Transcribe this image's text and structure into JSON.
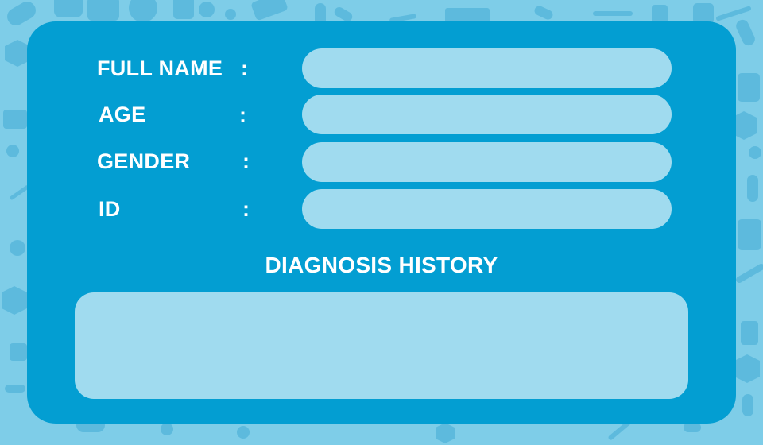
{
  "colors": {
    "background": "#7ecde8",
    "pattern": "#5ab8dc",
    "card": "#039ed2",
    "field": "#a0dbef",
    "text": "#ffffff"
  },
  "form": {
    "fields": [
      {
        "label": "FULL NAME",
        "colon": ":",
        "value": ""
      },
      {
        "label": "AGE",
        "colon": ":",
        "value": ""
      },
      {
        "label": "GENDER",
        "colon": ":",
        "value": ""
      },
      {
        "label": "ID",
        "colon": ":",
        "value": ""
      }
    ]
  },
  "history": {
    "title": "DIAGNOSIS HISTORY",
    "value": ""
  }
}
